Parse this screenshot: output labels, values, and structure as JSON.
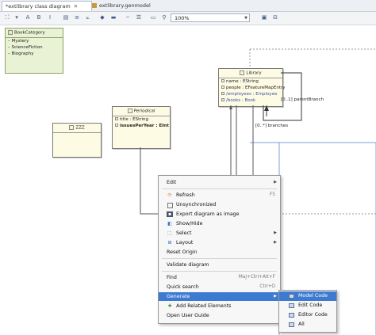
{
  "tabs": [
    {
      "label": "*extlibrary class diagram",
      "close": "✕"
    },
    {
      "label": "extlibrary.genmodel",
      "close": ""
    }
  ],
  "toolbar": {
    "zoom": "100%",
    "zoom_arrow": "▼"
  },
  "enum": {
    "name": "BookCategory",
    "literals": [
      "Mystery",
      "ScienceFiction",
      "Biography"
    ]
  },
  "classes": {
    "zzz": {
      "name": "ZZZ"
    },
    "periodical": {
      "name": "Periodical",
      "attributes": [
        "title : EString",
        "issuesPerYear : EInt"
      ]
    },
    "library": {
      "name": "Library",
      "attributes": [
        "name : EString",
        "people : EFeatureMapEntry",
        "/employees : Employee",
        "/books : Book"
      ]
    }
  },
  "edges": {
    "parent_branch": "[0..1] parentBranch",
    "branches": "[0..*] branches"
  },
  "context_menu": {
    "items": [
      {
        "label": "Edit",
        "submenu": true
      },
      {
        "label": "Refresh",
        "shortcut": "F5",
        "icon": "refresh-icon"
      },
      {
        "label": "Unsynchronized",
        "icon": "checkbox-icon"
      },
      {
        "label": "Export diagram as image",
        "icon": "export-image-icon"
      },
      {
        "label": "Show/Hide",
        "icon": "show-hide-icon"
      },
      {
        "label": "Select",
        "submenu": true,
        "icon": "select-icon"
      },
      {
        "label": "Layout",
        "submenu": true,
        "icon": "layout-icon"
      },
      {
        "label": "Reset Origin"
      },
      {
        "label": "Validate diagram"
      },
      {
        "label": "Find",
        "shortcut": "Maj+Ctrl+Alt+F"
      },
      {
        "label": "Quick search",
        "shortcut": "Ctrl+O"
      },
      {
        "label": "Generate",
        "submenu": true,
        "highlighted": true
      },
      {
        "label": "Add Related Elements",
        "icon": "add-related-icon"
      },
      {
        "label": "Open User Guide"
      }
    ]
  },
  "generate_submenu": {
    "items": [
      {
        "label": "Model Code",
        "highlighted": true
      },
      {
        "label": "Edit Code"
      },
      {
        "label": "Editor Code"
      },
      {
        "label": "All"
      }
    ]
  },
  "colors": {
    "highlight": "#3d7bd1",
    "enum_bg": "#e9f2d5",
    "class_bg": "#fdfbe3"
  }
}
